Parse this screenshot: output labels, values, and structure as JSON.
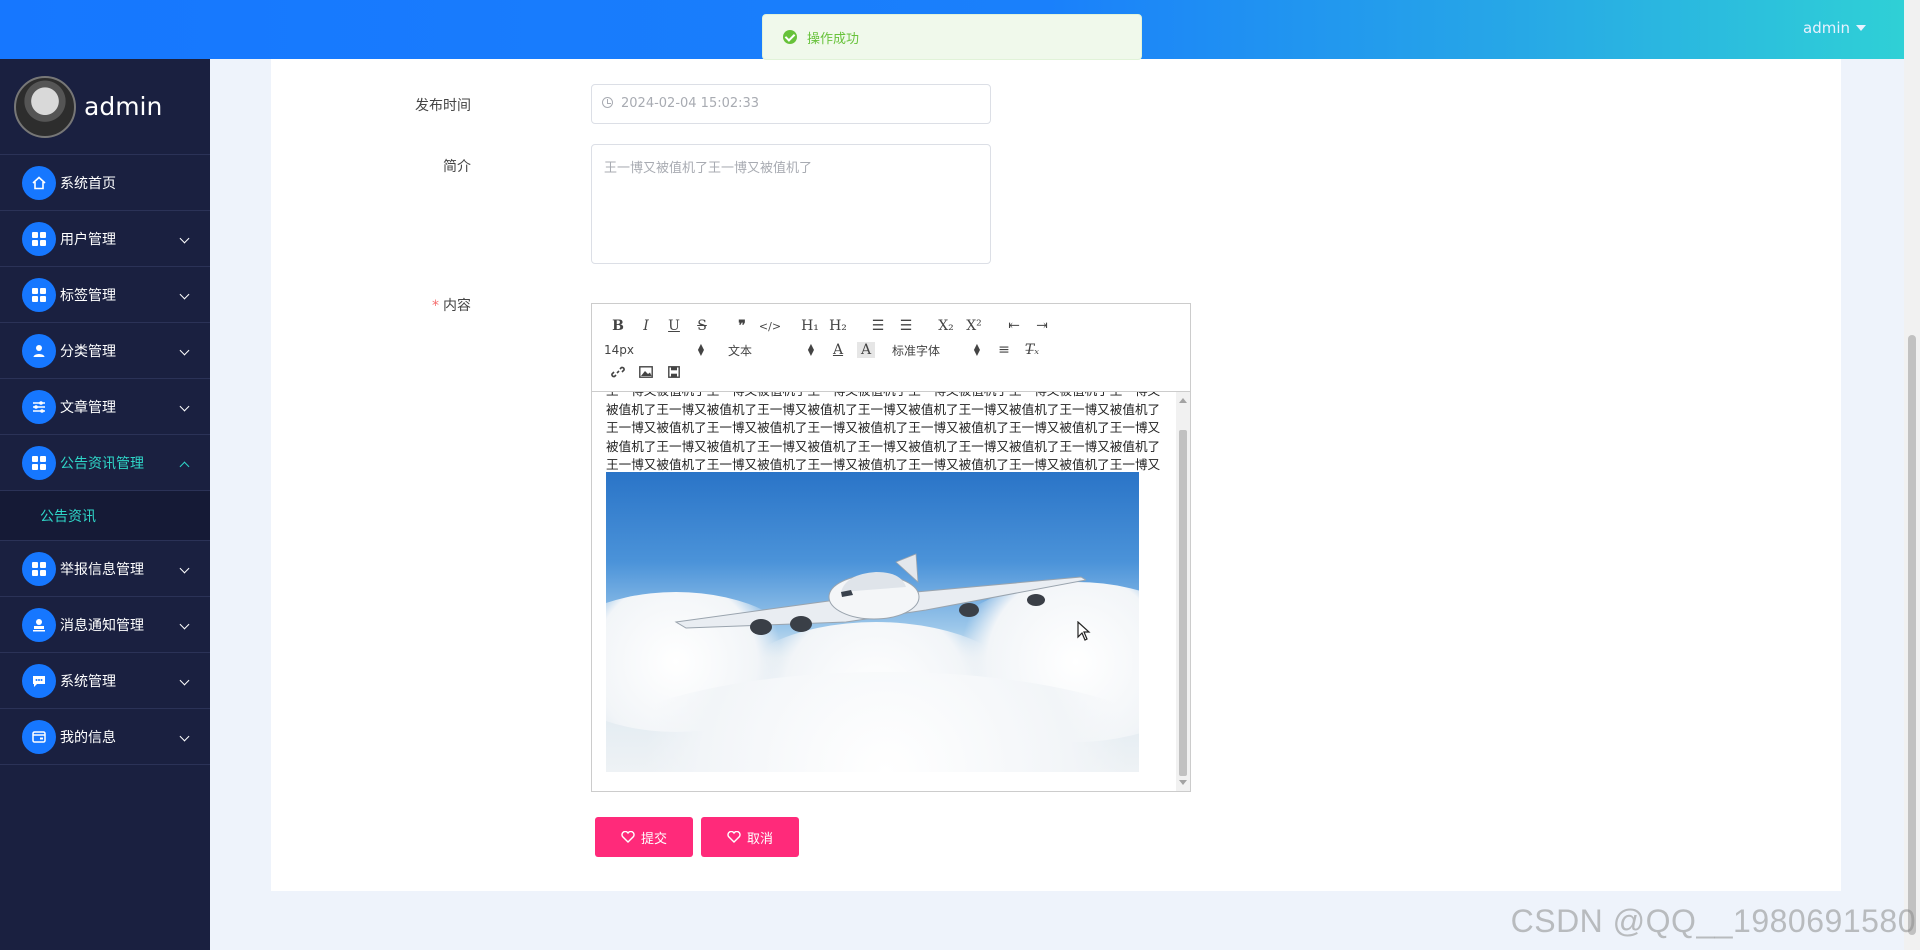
{
  "header": {
    "user_label": "admin"
  },
  "toast": {
    "message": "操作成功"
  },
  "sidebar": {
    "brand": "admin",
    "items": [
      {
        "label": "系统首页"
      },
      {
        "label": "用户管理"
      },
      {
        "label": "标签管理"
      },
      {
        "label": "分类管理"
      },
      {
        "label": "文章管理"
      },
      {
        "label": "公告资讯管理",
        "expanded": true,
        "children": [
          {
            "label": "公告资讯"
          }
        ]
      },
      {
        "label": "举报信息管理"
      },
      {
        "label": "消息通知管理"
      },
      {
        "label": "系统管理"
      },
      {
        "label": "我的信息"
      }
    ]
  },
  "form": {
    "publish_time": {
      "label": "发布时间",
      "value": "2024-02-04 15:02:33"
    },
    "summary": {
      "label": "简介",
      "value": "王一博又被值机了王一博又被值机了"
    },
    "content": {
      "label": "内容",
      "required_mark": "*",
      "toolbar": {
        "font_size": "14px",
        "block_type": "文本",
        "font_family": "标准字体"
      },
      "text": "王一博又被值机了王一博又被值机了王一博又被值机了王一博又被值机了王一博又被值机了王一博又被值机了王一博又被值机了王一博又被值机了王一博又被值机了王一博又被值机了王一博又被值机了王一博又被值机了王一博又被值机了王一博又被值机了王一博又被值机了王一博又被值机了王一博又被值机了王一博又被值机了王一博又被值机了王一博又被值机了王一博又被值机了王一博又被值机了王一博又被值机了王一博又被值机了王一博又被值机了王一博又被值机了王一博又被值机了王一博又被值机了"
    },
    "submit_label": "提交",
    "cancel_label": "取消"
  },
  "watermark": "CSDN @QQ__1980691580"
}
